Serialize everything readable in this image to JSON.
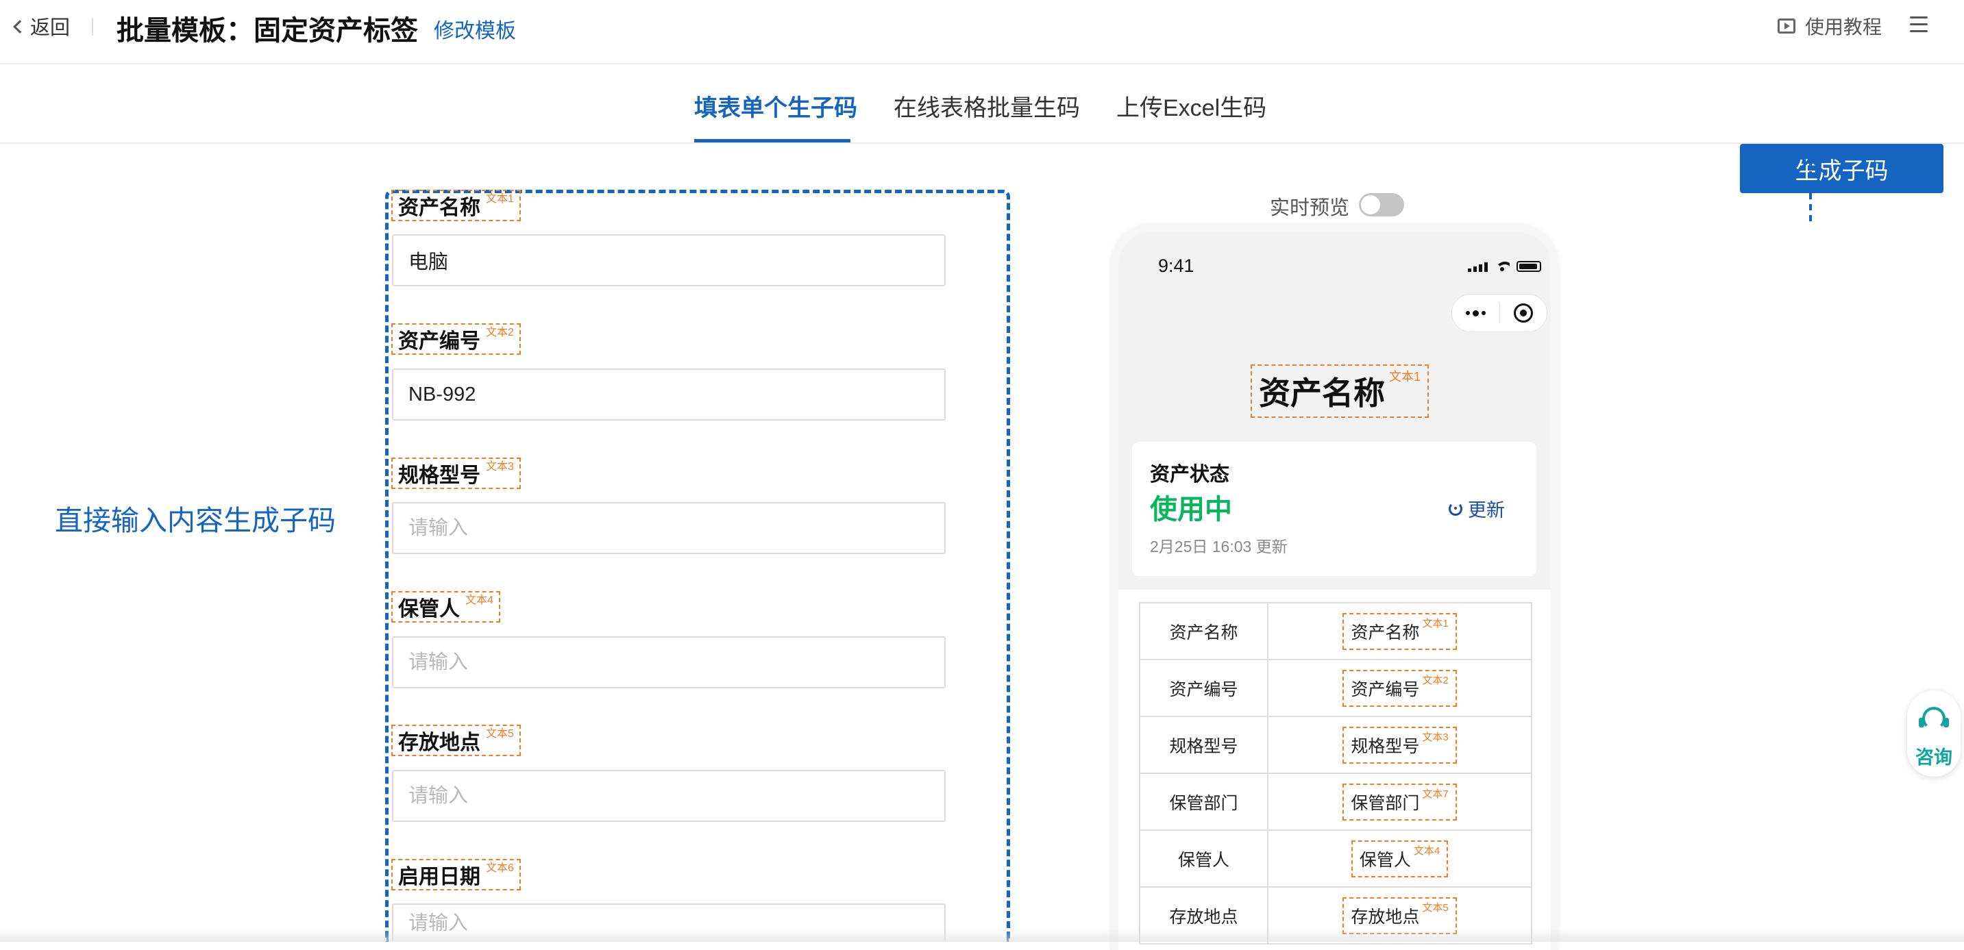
{
  "header": {
    "back_label": "返回",
    "title": "批量模板：固定资产标签",
    "edit_template_label": "修改模板",
    "tutorial_label": "使用教程"
  },
  "tabs": [
    {
      "label": "填表单个生子码",
      "active": true
    },
    {
      "label": "在线表格批量生码",
      "active": false
    },
    {
      "label": "上传Excel生码",
      "active": false
    }
  ],
  "generate_button_label": "生成子码",
  "hint_text": "直接输入内容生成子码",
  "form": {
    "fields": [
      {
        "label": "资产名称",
        "tag": "文本1",
        "value": "电脑",
        "placeholder": "请输入"
      },
      {
        "label": "资产编号",
        "tag": "文本2",
        "value": "NB-992",
        "placeholder": "请输入"
      },
      {
        "label": "规格型号",
        "tag": "文本3",
        "value": "",
        "placeholder": "请输入"
      },
      {
        "label": "保管人",
        "tag": "文本4",
        "value": "",
        "placeholder": "请输入"
      },
      {
        "label": "存放地点",
        "tag": "文本5",
        "value": "",
        "placeholder": "请输入"
      },
      {
        "label": "启用日期",
        "tag": "文本6",
        "value": "",
        "placeholder": "请输入"
      }
    ]
  },
  "preview": {
    "toggle_label": "实时预览",
    "toggle_on": false,
    "phone": {
      "time": "9:41",
      "title": "资产名称",
      "title_tag": "文本1",
      "status_card": {
        "title": "资产状态",
        "value": "使用中",
        "updated": "2月25日 16:03 更新",
        "refresh_label": "更新"
      },
      "table": [
        {
          "key": "资产名称",
          "value": "资产名称",
          "tag": "文本1"
        },
        {
          "key": "资产编号",
          "value": "资产编号",
          "tag": "文本2"
        },
        {
          "key": "规格型号",
          "value": "规格型号",
          "tag": "文本3"
        },
        {
          "key": "保管部门",
          "value": "保管部门",
          "tag": "文本7"
        },
        {
          "key": "保管人",
          "value": "保管人",
          "tag": "文本4"
        },
        {
          "key": "存放地点",
          "value": "存放地点",
          "tag": "文本5"
        }
      ]
    }
  },
  "consult_label": "咨询",
  "colors": {
    "accent": "#1565c0",
    "tag_orange": "#ef7d22",
    "status_green": "#0ab55f",
    "consult_teal": "#0ea5a0"
  }
}
